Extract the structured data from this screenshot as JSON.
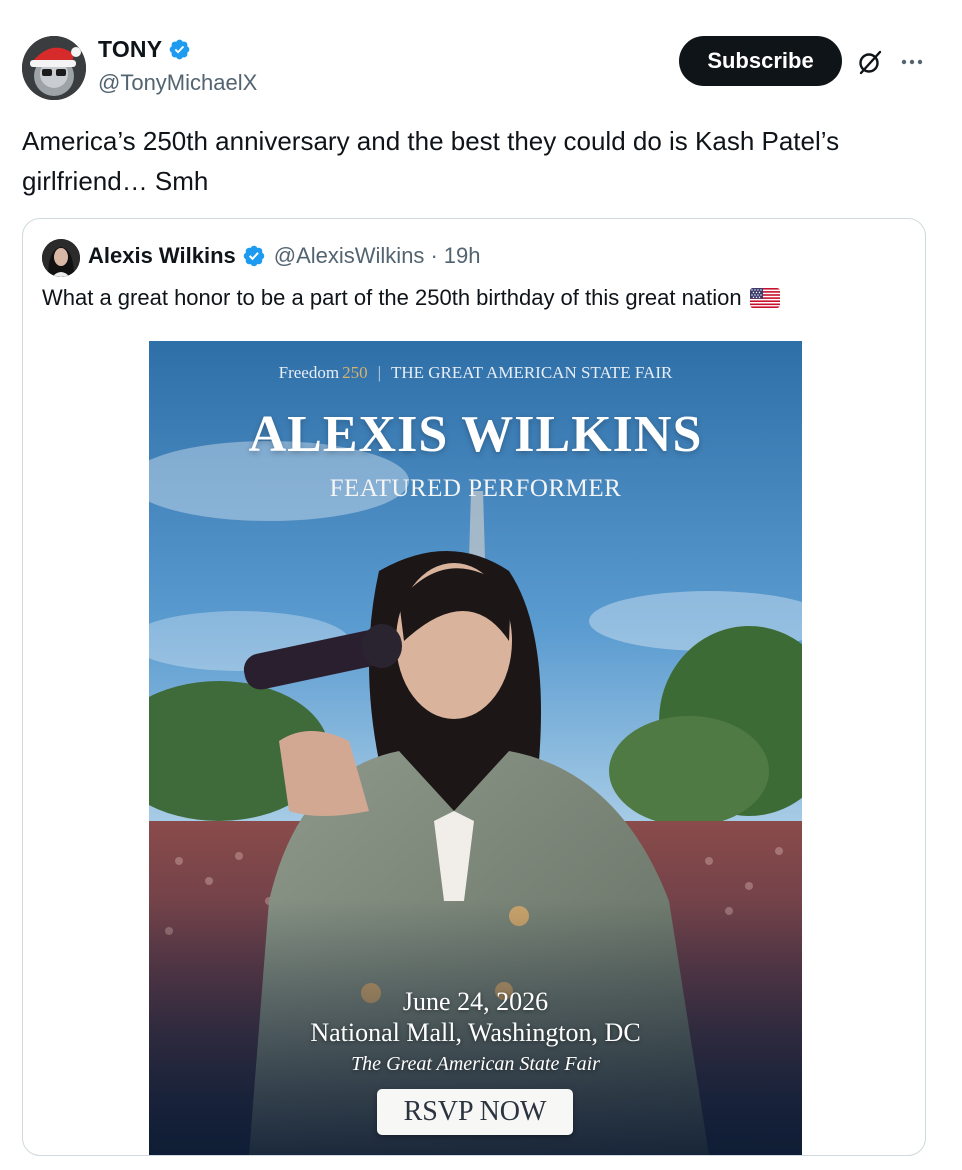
{
  "author": {
    "display_name": "TONY",
    "handle": "@TonyMichaelX",
    "verified_icon": "verified-badge-icon",
    "avatar_icon": "avatar"
  },
  "actions": {
    "subscribe_label": "Subscribe",
    "grok_icon": "grok-icon",
    "more_icon": "more-icon"
  },
  "tweet": {
    "text": "America’s 250th anniversary and the best they could do is Kash Patel’s girlfriend… Smh"
  },
  "quote": {
    "display_name": "Alexis Wilkins",
    "handle": "@AlexisWilkins",
    "separator": "·",
    "time": "19h",
    "text": "What a great honor to be a part of the 250th birthday of this great nation",
    "flag_icon": "us-flag-icon"
  },
  "poster": {
    "brand": "Freedom",
    "brand_number": "250",
    "separator": "|",
    "event_name": "THE GREAT AMERICAN STATE FAIR",
    "title": "ALEXIS WILKINS",
    "subtitle": "FEATURED PERFORMER",
    "date": "June 24, 2026",
    "location": "National Mall, Washington, DC",
    "event_tagline": "The Great American State Fair",
    "rsvp_label": "RSVP NOW"
  },
  "colors": {
    "verified_blue": "#1d9bf0",
    "text_primary": "#0f1419",
    "text_secondary": "#536471",
    "button_dark": "#0f1419",
    "card_border": "#cfd9de"
  }
}
